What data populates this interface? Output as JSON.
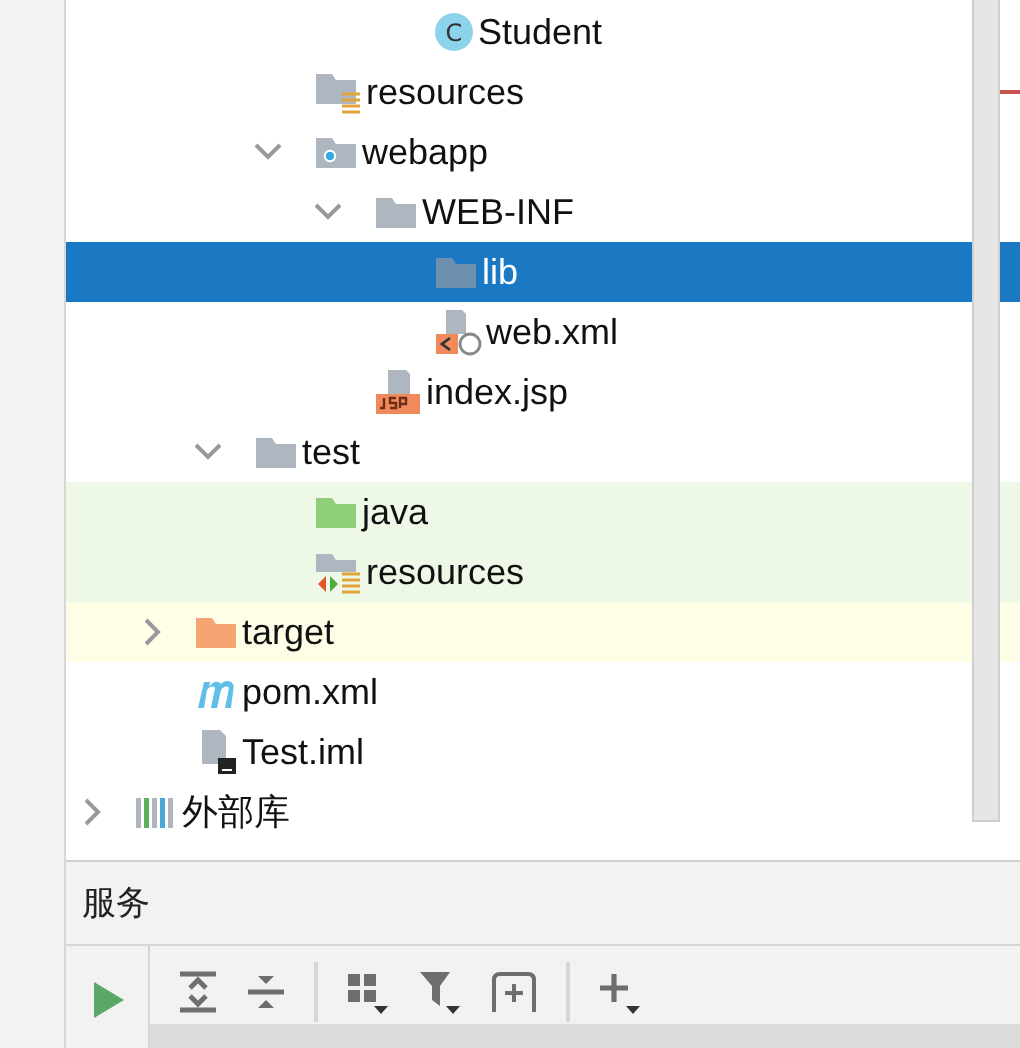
{
  "tree": [
    {
      "children": [
        {
          "children": [
            {
              "children": [
                {
                  "children": [
                    {
                      "children": [
                        {
                          "label": "Student",
                          "kind": "class",
                          "icon_letter": "C",
                          "selected": false
                        }
                      ]
                    }
                  ]
                },
                {
                  "label": "resources",
                  "kind": "resource-folder",
                  "selected": false
                },
                {
                  "label": "webapp",
                  "kind": "web-folder",
                  "expanded": true,
                  "selected": false,
                  "children": [
                    {
                      "label": "WEB-INF",
                      "kind": "folder",
                      "expanded": true,
                      "selected": false,
                      "children": [
                        {
                          "label": "lib",
                          "kind": "folder",
                          "selected": true
                        },
                        {
                          "label": "web.xml",
                          "kind": "xml-file",
                          "selected": false
                        }
                      ]
                    },
                    {
                      "label": "index.jsp",
                      "kind": "jsp-file",
                      "selected": false
                    }
                  ]
                }
              ]
            },
            {
              "label": "test",
              "kind": "folder",
              "expanded": true,
              "selected": false,
              "children": [
                {
                  "label": "java",
                  "kind": "test-source-folder",
                  "color": "#eef8e6",
                  "selected": false
                },
                {
                  "label": "resources",
                  "kind": "test-resource-folder",
                  "color": "#eef8e6",
                  "selected": false
                }
              ]
            }
          ]
        },
        {
          "label": "target",
          "kind": "excluded-folder",
          "color": "#fefde6",
          "expanded": false,
          "selected": false
        },
        {
          "label": "pom.xml",
          "kind": "maven-file",
          "selected": false
        },
        {
          "label": "Test.iml",
          "kind": "iml-file",
          "selected": false
        }
      ]
    },
    {
      "label": "外部库",
      "kind": "library",
      "expanded": false,
      "selected": false
    }
  ],
  "services_panel": {
    "title": "服务"
  }
}
